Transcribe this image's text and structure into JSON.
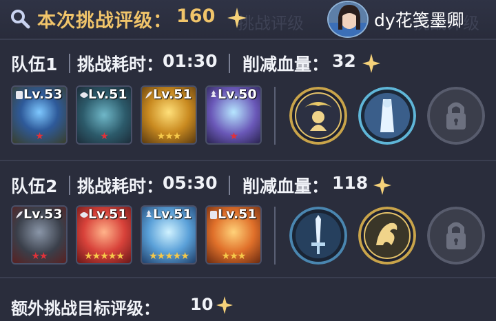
{
  "header": {
    "rating_label": "本次挑战评级：",
    "rating_value": "160",
    "ghost_text_1": "挑战评级",
    "ghost_text_2": "挑战评级",
    "player_name": "dy花笺墨卿"
  },
  "teams": [
    {
      "label": "队伍1",
      "time_label": "挑战耗时：",
      "time_value": "01:30",
      "damage_label": "削减血量：",
      "damage_value": "32",
      "heroes": [
        {
          "level": "Lv.53",
          "stars": "★",
          "class_icon": "tank-icon"
        },
        {
          "level": "Lv.51",
          "stars": "★",
          "class_icon": "support-icon"
        },
        {
          "level": "Lv.51",
          "stars": "★★★",
          "class_icon": "mage-icon"
        },
        {
          "level": "Lv.50",
          "stars": "★",
          "class_icon": "priest-icon"
        }
      ],
      "skills": [
        "golden-spirit-skill-icon",
        "ice-sage-skill-icon",
        "lock-icon"
      ]
    },
    {
      "label": "队伍2",
      "time_label": "挑战耗时：",
      "time_value": "05:30",
      "damage_label": "削减血量：",
      "damage_value": "118",
      "heroes": [
        {
          "level": "Lv.53",
          "stars": "★★",
          "class_icon": "mage-icon"
        },
        {
          "level": "Lv.51",
          "stars": "★★★★★",
          "class_icon": "support-icon"
        },
        {
          "level": "Lv.51",
          "stars": "★★★★★",
          "class_icon": "priest-icon"
        },
        {
          "level": "Lv.51",
          "stars": "★★★",
          "class_icon": "tank-icon"
        }
      ],
      "skills": [
        "ice-sword-skill-icon",
        "golden-dragon-skill-icon",
        "lock-icon"
      ]
    }
  ],
  "extra": {
    "label": "额外挑战目标评级：",
    "value": "10"
  },
  "colors": {
    "gold": "#f0c46a",
    "star_red": "#e0323a",
    "star_gold": "#f6c94a",
    "background": "#2a2d3c"
  }
}
